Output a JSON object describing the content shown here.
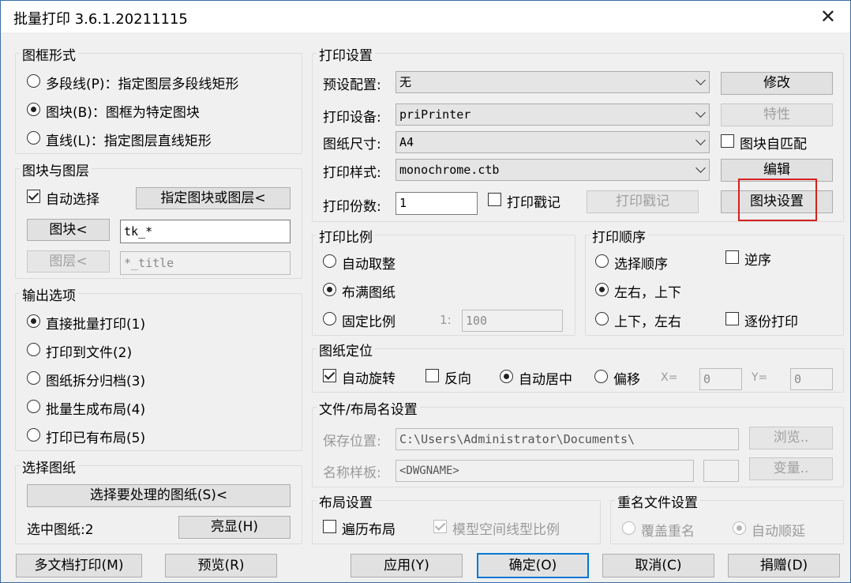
{
  "window": {
    "title": "批量打印 3.6.1.20211115"
  },
  "frame_form": {
    "title": "图框形式",
    "opt_polyline": "多段线(P)：指定图层多段线矩形",
    "opt_block": "图块(B)：图框为特定图块",
    "opt_line": "直线(L)：指定图层直线矩形",
    "selected": "block"
  },
  "block_layer": {
    "title": "图块与图层",
    "auto_select": "自动选择",
    "auto_select_checked": true,
    "specify_button": "指定图块或图层<",
    "block_button": "图块<",
    "block_value": "tk_*",
    "layer_button": "图层<",
    "layer_value": "*_title"
  },
  "output": {
    "title": "输出选项",
    "opt1": "直接批量打印(1)",
    "opt2": "打印到文件(2)",
    "opt3": "图纸拆分归档(3)",
    "opt4": "批量生成布局(4)",
    "opt5": "打印已有布局(5)",
    "selected": "opt1"
  },
  "select_sheets": {
    "title": "选择图纸",
    "select_button": "选择要处理的图纸(S)<",
    "selected_label": "选中图纸:2",
    "highlight_button": "亮显(H)"
  },
  "print_settings": {
    "title": "打印设置",
    "preset_label": "预设配置:",
    "preset_value": "无",
    "modify_button": "修改",
    "device_label": "打印设备:",
    "device_value": "priPrinter",
    "properties_button": "特性",
    "paper_label": "图纸尺寸:",
    "paper_value": "A4",
    "block_match": "图块自匹配",
    "style_label": "打印样式:",
    "style_value": "monochrome.ctb",
    "edit_button": "编辑",
    "copies_label": "打印份数:",
    "copies_value": "1",
    "stamp_check": "打印戳记",
    "stamp_button": "打印戳记",
    "block_settings_button": "图块设置"
  },
  "scale": {
    "title": "打印比例",
    "auto_fit": "自动取整",
    "fill_paper": "布满图纸",
    "fixed_scale": "固定比例",
    "ratio_prefix": "1:",
    "ratio_value": "100",
    "selected": "fill_paper"
  },
  "order": {
    "title": "打印顺序",
    "select_order": "选择顺序",
    "reverse": "逆序",
    "lr_tb": "左右，上下",
    "tb_lr": "上下，左右",
    "per_copy": "逐份打印",
    "selected": "lr_tb"
  },
  "position": {
    "title": "图纸定位",
    "auto_rotate": "自动旋转",
    "reverse": "反向",
    "auto_center": "自动居中",
    "offset": "偏移",
    "x_label": "X=",
    "x_value": "0",
    "y_label": "Y=",
    "y_value": "0"
  },
  "file_naming": {
    "title": "文件/布局名设置",
    "save_label": "保存位置:",
    "save_value": "C:\\Users\\Administrator\\Documents\\",
    "browse_button": "浏览..",
    "name_label": "名称样板:",
    "name_value": "<DWGNAME>",
    "variable_button": "变量.."
  },
  "layout": {
    "title": "布局设置",
    "traverse": "遍历布局",
    "model_scale": "模型空间线型比例"
  },
  "rename": {
    "title": "重名文件设置",
    "overwrite": "覆盖重名",
    "auto_increment": "自动顺延"
  },
  "footer": {
    "multi_doc": "多文档打印(M)",
    "preview": "预览(R)",
    "apply": "应用(Y)",
    "ok": "确定(O)",
    "cancel": "取消(C)",
    "donate": "捐赠(D)"
  }
}
